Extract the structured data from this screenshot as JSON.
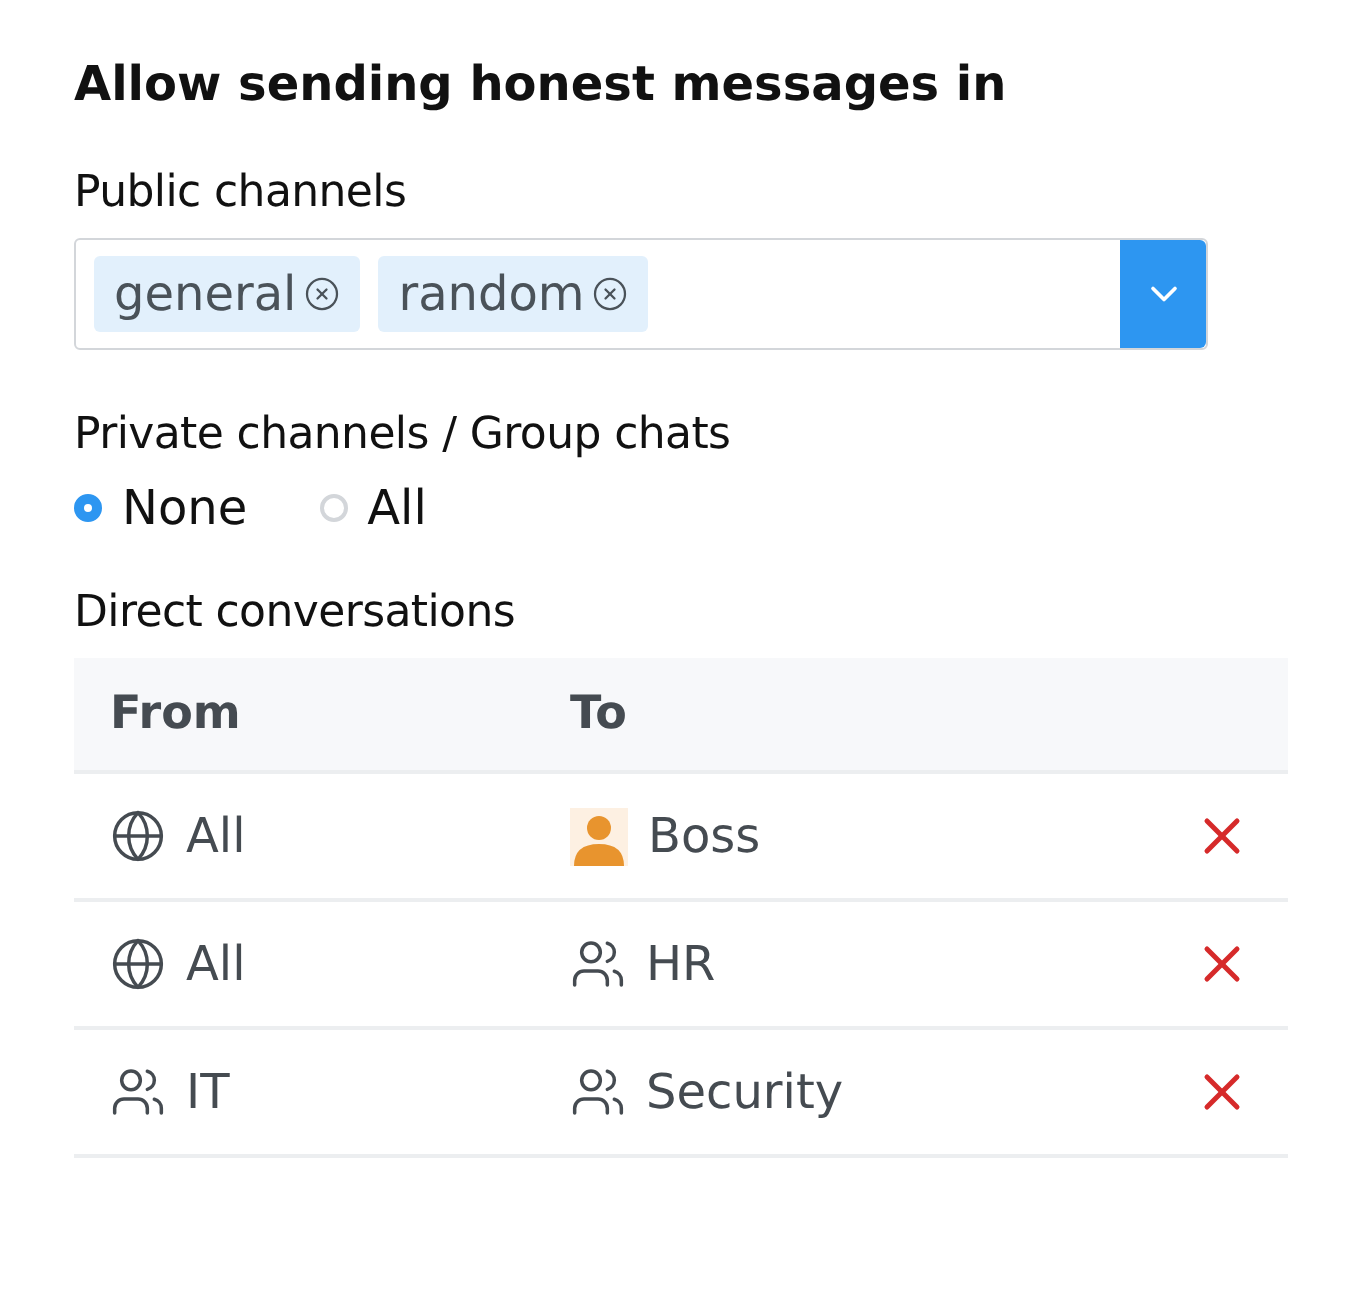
{
  "title": "Allow sending honest messages in",
  "public_channels": {
    "label": "Public channels",
    "tags": [
      {
        "label": "general"
      },
      {
        "label": "random"
      }
    ]
  },
  "private_channels": {
    "label": "Private channels / Group chats",
    "options": [
      {
        "label": "None",
        "selected": true
      },
      {
        "label": "All",
        "selected": false
      }
    ]
  },
  "direct_conversations": {
    "label": "Direct conversations",
    "columns": [
      "From",
      "To"
    ],
    "rows": [
      {
        "from": {
          "kind": "everyone",
          "label": "All"
        },
        "to": {
          "kind": "user",
          "label": "Boss"
        }
      },
      {
        "from": {
          "kind": "everyone",
          "label": "All"
        },
        "to": {
          "kind": "group",
          "label": "HR"
        }
      },
      {
        "from": {
          "kind": "group",
          "label": "IT"
        },
        "to": {
          "kind": "group",
          "label": "Security"
        }
      }
    ]
  }
}
